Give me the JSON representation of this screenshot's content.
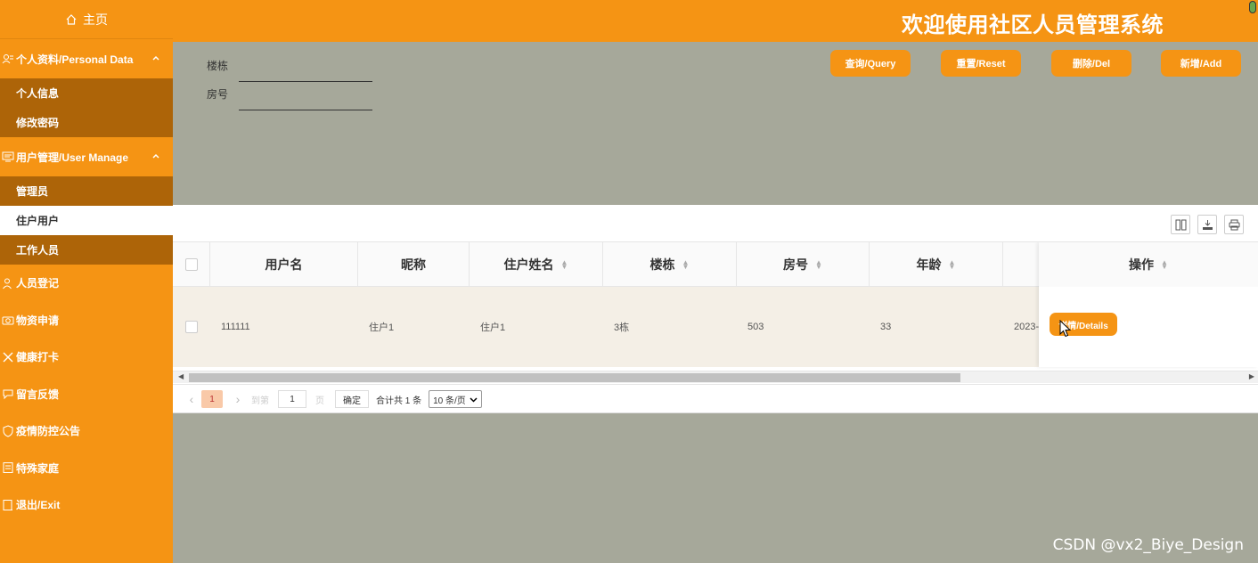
{
  "header": {
    "title": "欢迎使用社区人员管理系统"
  },
  "sidebar": {
    "home": "主页",
    "groups": [
      {
        "label": "个人资料/Personal Data",
        "items": [
          "个人信息",
          "修改密码"
        ]
      },
      {
        "label": "用户管理/User Manage",
        "items": [
          "管理员",
          "住户用户",
          "工作人员"
        ]
      }
    ],
    "items": [
      "人员登记",
      "物资申请",
      "健康打卡",
      "留言反馈",
      "疫情防控公告",
      "特殊家庭",
      "退出/Exit"
    ]
  },
  "search": {
    "building_label": "楼栋",
    "room_label": "房号",
    "buttons": {
      "query": "查询/Query",
      "reset": "重置/Reset",
      "delete": "删除/Del",
      "add": "新增/Add"
    }
  },
  "table": {
    "headers": [
      "用户名",
      "昵称",
      "住户姓名",
      "楼栋",
      "房号",
      "年龄",
      "操作"
    ],
    "rows": [
      {
        "username": "111111",
        "nickname": "住户1",
        "name": "住户1",
        "building": "3栋",
        "room": "503",
        "age": "33",
        "date": "2023-"
      }
    ],
    "detail_button": "详情/Details"
  },
  "pager": {
    "current": "1",
    "goto": "到第",
    "goto_value": "1",
    "page_unit": "页",
    "confirm": "确定",
    "total": "合计共 1 条",
    "page_size": "10 条/页"
  },
  "watermark": "CSDN @vx2_Biye_Design",
  "colors": {
    "primary": "#f59414",
    "sidebar_sub": "#ad6408",
    "background": "#a6a89a"
  }
}
